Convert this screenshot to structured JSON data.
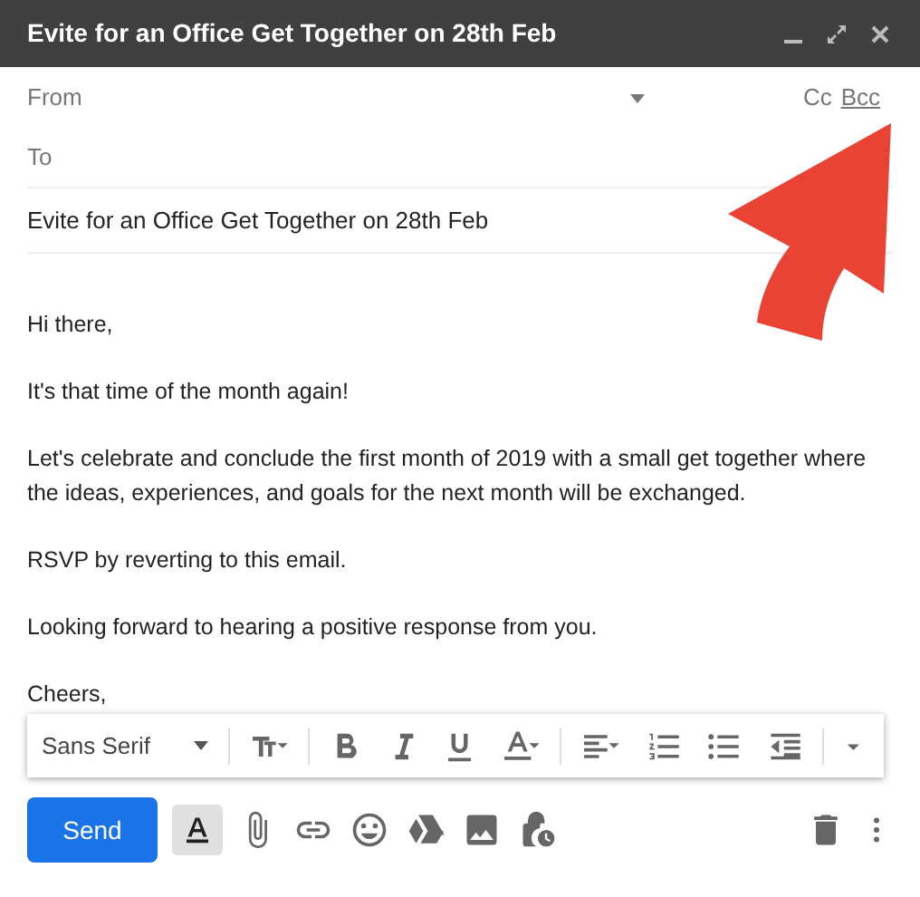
{
  "window": {
    "title": "Evite for an Office Get Together on 28th Feb"
  },
  "from": {
    "label": "From"
  },
  "cc": "Cc",
  "bcc": "Bcc",
  "to": {
    "label": "To"
  },
  "subject": {
    "value": "Evite for an Office Get Together on 28th Feb"
  },
  "body": [
    "Hi there,",
    "It's that time of the month again!",
    "Let's celebrate and conclude the first month of 2019 with a small get together where the ideas, experiences, and goals for the next month will be exchanged.",
    "RSVP by reverting to this email.",
    "Looking forward to hearing a positive response from you.",
    "Cheers,"
  ],
  "formatting_bar": {
    "font": "Sans Serif"
  },
  "bottom_bar": {
    "send": "Send",
    "formatting_toggle": {
      "selected": true
    }
  }
}
